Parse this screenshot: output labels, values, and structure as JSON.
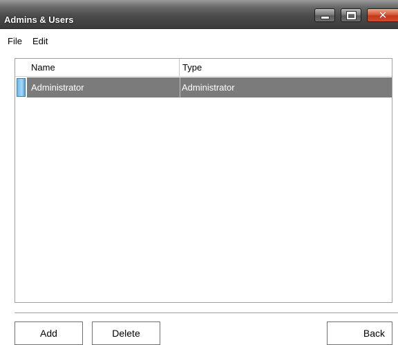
{
  "window": {
    "title": "Admins & Users",
    "controls": {
      "minimize_icon": "minimize-icon",
      "maximize_icon": "maximize-icon",
      "close_icon": "close-icon",
      "close_glyph": "✕"
    }
  },
  "menu": {
    "items": [
      {
        "label": "File"
      },
      {
        "label": "Edit"
      }
    ]
  },
  "list": {
    "columns": [
      "Name",
      "Type"
    ],
    "rows": [
      {
        "name": "Administrator",
        "type": "Administrator",
        "selected": true
      }
    ],
    "selection_color": "#7b7b7b",
    "marker_color": "#6fb8e8"
  },
  "buttons": {
    "add": "Add",
    "delete": "Delete",
    "back": "Back"
  }
}
